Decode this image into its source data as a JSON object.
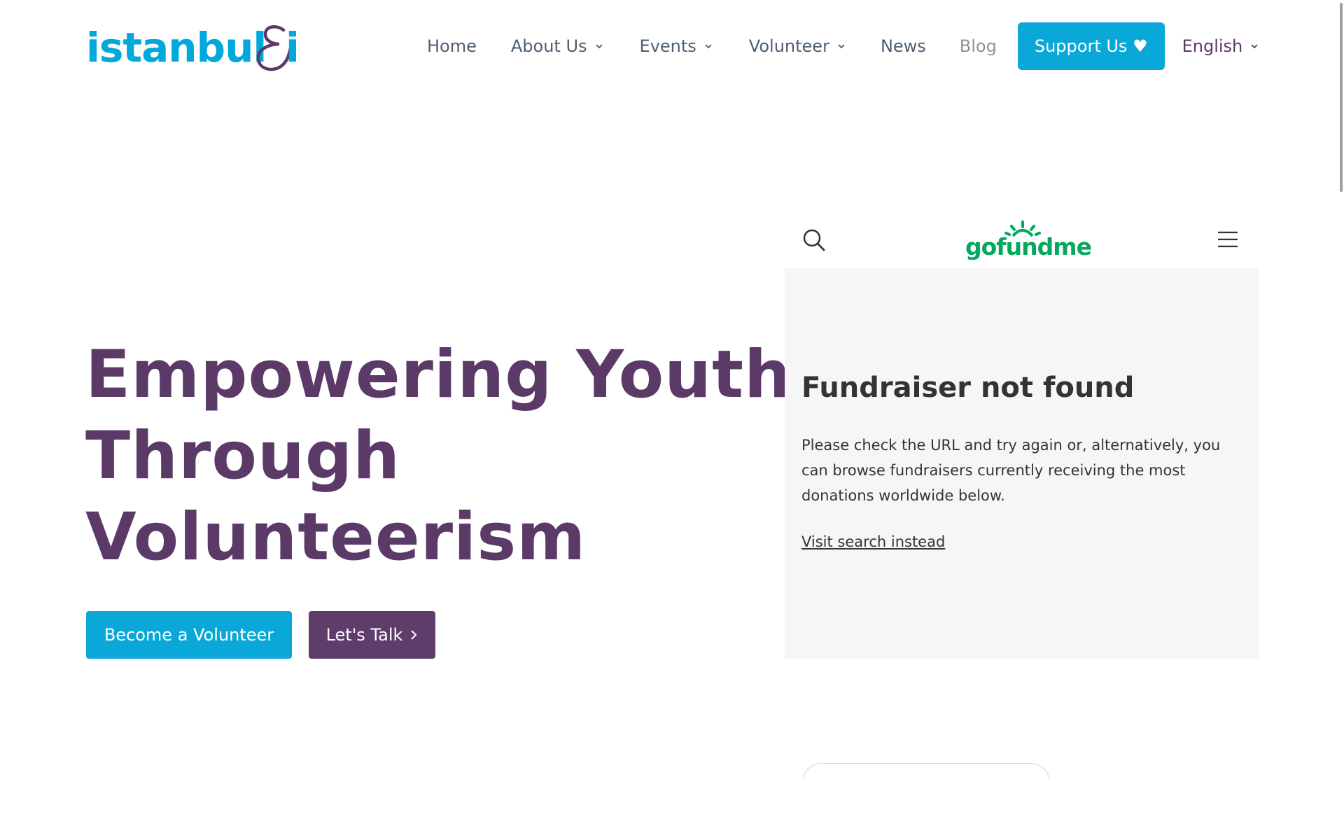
{
  "brand": {
    "logo_word": "istanbul",
    "logo_tail": "i",
    "primary_color": "#00a8dc",
    "accent_color": "#5b3a68"
  },
  "nav": {
    "home": "Home",
    "about": "About Us",
    "events": "Events",
    "volunteer": "Volunteer",
    "news": "News",
    "blog": "Blog",
    "support": "Support Us ♥",
    "language": "English"
  },
  "hero": {
    "title_line1": "Empowering Youth",
    "title_line2": "Through",
    "title_line3": "Volunteerism",
    "primary_button": "Become a Volunteer",
    "secondary_button": "Let's Talk"
  },
  "embed": {
    "logo_text": "gofundme",
    "brand_color": "#02a95c",
    "title": "Fundraiser not found",
    "message": "Please check the URL and try again or, alternatively, you can browse fundraisers currently receiving the most donations worldwide below.",
    "link": "Visit search instead",
    "icons": [
      "search-icon",
      "menu-icon"
    ]
  }
}
